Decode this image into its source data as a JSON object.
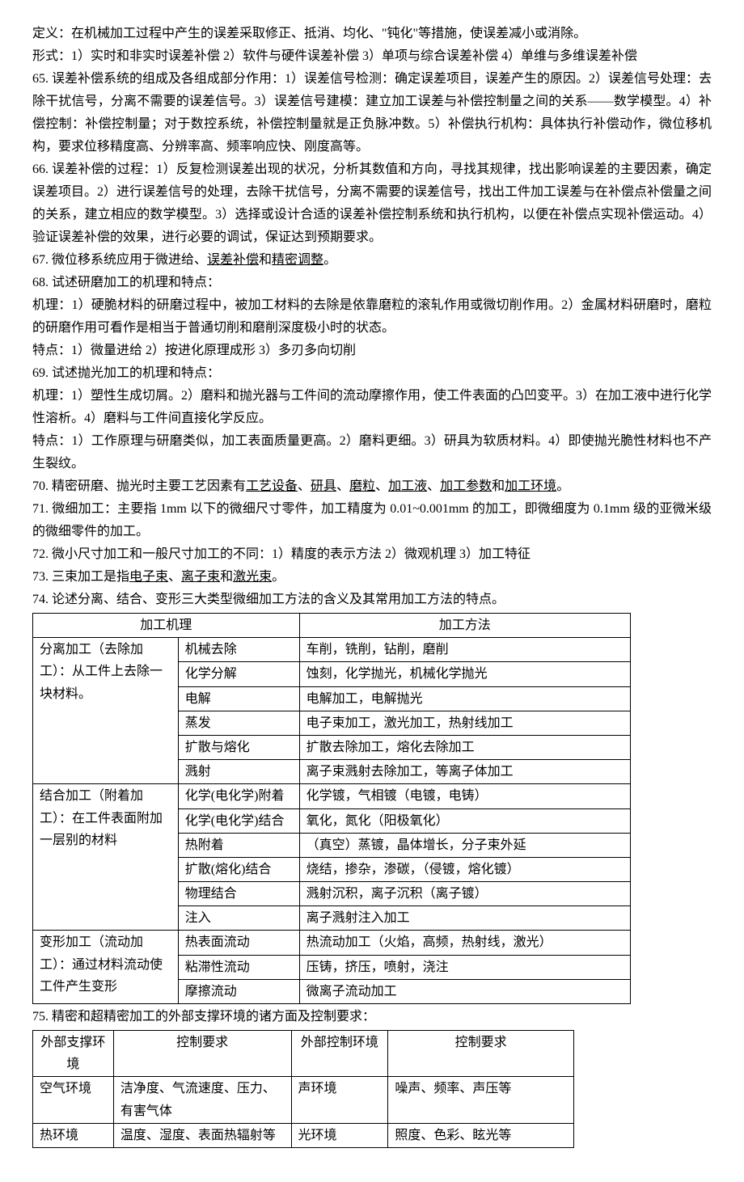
{
  "p_def": "定义：在机械加工过程中产生的误差采取修正、抵消、均化、\"钝化\"等措施，使误差减小或消除。",
  "p_form": "形式：1）实时和非实时误差补偿 2）软件与硬件误差补偿 3）单项与综合误差补偿 4）单维与多维误差补偿",
  "p65": "65. 误差补偿系统的组成及各组成部分作用：1）误差信号检测：确定误差项目，误差产生的原因。2）误差信号处理：去除干扰信号，分离不需要的误差信号。3）误差信号建模：建立加工误差与补偿控制量之间的关系——数学模型。4）补偿控制：补偿控制量；对于数控系统，补偿控制量就是正负脉冲数。5）补偿执行机构：具体执行补偿动作，微位移机构，要求位移精度高、分辨率高、频率响应快、刚度高等。",
  "p66": "66. 误差补偿的过程：1）反复检测误差出现的状况，分析其数值和方向，寻找其规律，找出影响误差的主要因素，确定误差项目。2）进行误差信号的处理，去除干扰信号，分离不需要的误差信号，找出工件加工误差与在补偿点补偿量之间的关系，建立相应的数学模型。3）选择或设计合适的误差补偿控制系统和执行机构，以便在补偿点实现补偿运动。4）验证误差补偿的效果，进行必要的调试，保证达到预期要求。",
  "p67_a": "67. 微位移系统应用于微进给、",
  "p67_u1": "误差补偿",
  "p67_b": "和",
  "p67_u2": "精密调整",
  "p67_c": "。",
  "p68": "68. 试述研磨加工的机理和特点：",
  "p68a": "机理：1）硬脆材料的研磨过程中，被加工材料的去除是依靠磨粒的滚轧作用或微切削作用。2）金属材料研磨时，磨粒的研磨作用可看作是相当于普通切削和磨削深度极小时的状态。",
  "p68b": "特点：1）微量进给 2）按进化原理成形 3）多刃多向切削",
  "p69": "69. 试述抛光加工的机理和特点：",
  "p69a": "机理：1）塑性生成切屑。2）磨料和抛光器与工件间的流动摩擦作用，使工件表面的凸凹变平。3）在加工液中进行化学性溶析。4）磨料与工件间直接化学反应。",
  "p69b": "特点：1）工作原理与研磨类似，加工表面质量更高。2）磨料更细。3）研具为软质材料。4）即使抛光脆性材料也不产生裂纹。",
  "p70_a": "70. 精密研磨、抛光时主要工艺因素有",
  "p70_u1": "工艺设备",
  "p70_u2": "研具",
  "p70_u3": "磨粒",
  "p70_u4": "加工液",
  "p70_u5": "加工参数",
  "p70_u6": "加工环境",
  "sep_dun": "、",
  "sep_he": "和",
  "sep_period": "。",
  "p71": "71. 微细加工：主要指 1mm 以下的微细尺寸零件，加工精度为 0.01~0.001mm 的加工，即微细度为 0.1mm 级的亚微米级的微细零件的加工。",
  "p72": "72. 微小尺寸加工和一般尺寸加工的不同：1）精度的表示方法 2）微观机理 3）加工特征",
  "p73_a": "73. 三束加工是指",
  "p73_u1": "电子束",
  "p73_u2": "离子束",
  "p73_u3": "激光束",
  "p74": "74. 论述分离、结合、变形三大类型微细加工方法的含义及其常用加工方法的特点。",
  "t1": {
    "h1": "加工机理",
    "h2": "加工方法",
    "g1_name": "分离加工（去除加工）：从工件上去除一块材料。",
    "g1": [
      [
        "机械去除",
        "车削，铣削，钻削，磨削"
      ],
      [
        "化学分解",
        "蚀刻，化学抛光，机械化学抛光"
      ],
      [
        "电解",
        "电解加工，电解抛光"
      ],
      [
        "蒸发",
        "电子束加工，激光加工，热射线加工"
      ],
      [
        "扩散与熔化",
        "扩散去除加工，熔化去除加工"
      ],
      [
        "溅射",
        "离子束溅射去除加工，等离子体加工"
      ]
    ],
    "g2_name": "结合加工（附着加工）：在工件表面附加一层别的材料",
    "g2": [
      [
        "化学(电化学)附着",
        "化学镀，气相镀（电镀，电铸）"
      ],
      [
        "化学(电化学)结合",
        "氧化，氮化（阳极氧化）"
      ],
      [
        "热附着",
        "（真空）蒸镀，晶体增长，分子束外延"
      ],
      [
        "扩散(熔化)结合",
        "烧结，掺杂，渗碳，（侵镀，熔化镀）"
      ],
      [
        "物理结合",
        "溅射沉积，离子沉积（离子镀）"
      ],
      [
        "注入",
        "离子溅射注入加工"
      ]
    ],
    "g3_name": "变形加工（流动加工）：通过材料流动使工件产生变形",
    "g3": [
      [
        "热表面流动",
        "热流动加工（火焰，高频，热射线，激光）"
      ],
      [
        "粘滞性流动",
        "压铸，挤压，喷射，浇注"
      ],
      [
        "摩擦流动",
        "微离子流动加工"
      ]
    ]
  },
  "p75": "75. 精密和超精密加工的外部支撑环境的诸方面及控制要求：",
  "t2": {
    "h1": "外部支撑环境",
    "h2": "控制要求",
    "h3": "外部控制环境",
    "h4": "控制要求",
    "rows": [
      [
        "空气环境",
        "洁净度、气流速度、压力、有害气体",
        "声环境",
        "噪声、频率、声压等"
      ],
      [
        "热环境",
        "温度、湿度、表面热辐射等",
        "光环境",
        "照度、色彩、眩光等"
      ]
    ]
  }
}
